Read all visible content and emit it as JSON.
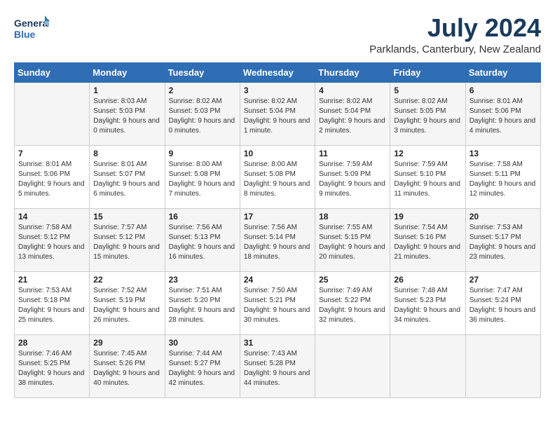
{
  "header": {
    "logo_line1": "General",
    "logo_line2": "Blue",
    "month_year": "July 2024",
    "location": "Parklands, Canterbury, New Zealand"
  },
  "days_of_week": [
    "Sunday",
    "Monday",
    "Tuesday",
    "Wednesday",
    "Thursday",
    "Friday",
    "Saturday"
  ],
  "weeks": [
    [
      {
        "day": "",
        "sunrise": "",
        "sunset": "",
        "daylight": ""
      },
      {
        "day": "1",
        "sunrise": "Sunrise: 8:03 AM",
        "sunset": "Sunset: 5:03 PM",
        "daylight": "Daylight: 9 hours and 0 minutes."
      },
      {
        "day": "2",
        "sunrise": "Sunrise: 8:02 AM",
        "sunset": "Sunset: 5:03 PM",
        "daylight": "Daylight: 9 hours and 0 minutes."
      },
      {
        "day": "3",
        "sunrise": "Sunrise: 8:02 AM",
        "sunset": "Sunset: 5:04 PM",
        "daylight": "Daylight: 9 hours and 1 minute."
      },
      {
        "day": "4",
        "sunrise": "Sunrise: 8:02 AM",
        "sunset": "Sunset: 5:04 PM",
        "daylight": "Daylight: 9 hours and 2 minutes."
      },
      {
        "day": "5",
        "sunrise": "Sunrise: 8:02 AM",
        "sunset": "Sunset: 5:05 PM",
        "daylight": "Daylight: 9 hours and 3 minutes."
      },
      {
        "day": "6",
        "sunrise": "Sunrise: 8:01 AM",
        "sunset": "Sunset: 5:06 PM",
        "daylight": "Daylight: 9 hours and 4 minutes."
      }
    ],
    [
      {
        "day": "7",
        "sunrise": "Sunrise: 8:01 AM",
        "sunset": "Sunset: 5:06 PM",
        "daylight": "Daylight: 9 hours and 5 minutes."
      },
      {
        "day": "8",
        "sunrise": "Sunrise: 8:01 AM",
        "sunset": "Sunset: 5:07 PM",
        "daylight": "Daylight: 9 hours and 6 minutes."
      },
      {
        "day": "9",
        "sunrise": "Sunrise: 8:00 AM",
        "sunset": "Sunset: 5:08 PM",
        "daylight": "Daylight: 9 hours and 7 minutes."
      },
      {
        "day": "10",
        "sunrise": "Sunrise: 8:00 AM",
        "sunset": "Sunset: 5:08 PM",
        "daylight": "Daylight: 9 hours and 8 minutes."
      },
      {
        "day": "11",
        "sunrise": "Sunrise: 7:59 AM",
        "sunset": "Sunset: 5:09 PM",
        "daylight": "Daylight: 9 hours and 9 minutes."
      },
      {
        "day": "12",
        "sunrise": "Sunrise: 7:59 AM",
        "sunset": "Sunset: 5:10 PM",
        "daylight": "Daylight: 9 hours and 11 minutes."
      },
      {
        "day": "13",
        "sunrise": "Sunrise: 7:58 AM",
        "sunset": "Sunset: 5:11 PM",
        "daylight": "Daylight: 9 hours and 12 minutes."
      }
    ],
    [
      {
        "day": "14",
        "sunrise": "Sunrise: 7:58 AM",
        "sunset": "Sunset: 5:12 PM",
        "daylight": "Daylight: 9 hours and 13 minutes."
      },
      {
        "day": "15",
        "sunrise": "Sunrise: 7:57 AM",
        "sunset": "Sunset: 5:12 PM",
        "daylight": "Daylight: 9 hours and 15 minutes."
      },
      {
        "day": "16",
        "sunrise": "Sunrise: 7:56 AM",
        "sunset": "Sunset: 5:13 PM",
        "daylight": "Daylight: 9 hours and 16 minutes."
      },
      {
        "day": "17",
        "sunrise": "Sunrise: 7:56 AM",
        "sunset": "Sunset: 5:14 PM",
        "daylight": "Daylight: 9 hours and 18 minutes."
      },
      {
        "day": "18",
        "sunrise": "Sunrise: 7:55 AM",
        "sunset": "Sunset: 5:15 PM",
        "daylight": "Daylight: 9 hours and 20 minutes."
      },
      {
        "day": "19",
        "sunrise": "Sunrise: 7:54 AM",
        "sunset": "Sunset: 5:16 PM",
        "daylight": "Daylight: 9 hours and 21 minutes."
      },
      {
        "day": "20",
        "sunrise": "Sunrise: 7:53 AM",
        "sunset": "Sunset: 5:17 PM",
        "daylight": "Daylight: 9 hours and 23 minutes."
      }
    ],
    [
      {
        "day": "21",
        "sunrise": "Sunrise: 7:53 AM",
        "sunset": "Sunset: 5:18 PM",
        "daylight": "Daylight: 9 hours and 25 minutes."
      },
      {
        "day": "22",
        "sunrise": "Sunrise: 7:52 AM",
        "sunset": "Sunset: 5:19 PM",
        "daylight": "Daylight: 9 hours and 26 minutes."
      },
      {
        "day": "23",
        "sunrise": "Sunrise: 7:51 AM",
        "sunset": "Sunset: 5:20 PM",
        "daylight": "Daylight: 9 hours and 28 minutes."
      },
      {
        "day": "24",
        "sunrise": "Sunrise: 7:50 AM",
        "sunset": "Sunset: 5:21 PM",
        "daylight": "Daylight: 9 hours and 30 minutes."
      },
      {
        "day": "25",
        "sunrise": "Sunrise: 7:49 AM",
        "sunset": "Sunset: 5:22 PM",
        "daylight": "Daylight: 9 hours and 32 minutes."
      },
      {
        "day": "26",
        "sunrise": "Sunrise: 7:48 AM",
        "sunset": "Sunset: 5:23 PM",
        "daylight": "Daylight: 9 hours and 34 minutes."
      },
      {
        "day": "27",
        "sunrise": "Sunrise: 7:47 AM",
        "sunset": "Sunset: 5:24 PM",
        "daylight": "Daylight: 9 hours and 36 minutes."
      }
    ],
    [
      {
        "day": "28",
        "sunrise": "Sunrise: 7:46 AM",
        "sunset": "Sunset: 5:25 PM",
        "daylight": "Daylight: 9 hours and 38 minutes."
      },
      {
        "day": "29",
        "sunrise": "Sunrise: 7:45 AM",
        "sunset": "Sunset: 5:26 PM",
        "daylight": "Daylight: 9 hours and 40 minutes."
      },
      {
        "day": "30",
        "sunrise": "Sunrise: 7:44 AM",
        "sunset": "Sunset: 5:27 PM",
        "daylight": "Daylight: 9 hours and 42 minutes."
      },
      {
        "day": "31",
        "sunrise": "Sunrise: 7:43 AM",
        "sunset": "Sunset: 5:28 PM",
        "daylight": "Daylight: 9 hours and 44 minutes."
      },
      {
        "day": "",
        "sunrise": "",
        "sunset": "",
        "daylight": ""
      },
      {
        "day": "",
        "sunrise": "",
        "sunset": "",
        "daylight": ""
      },
      {
        "day": "",
        "sunrise": "",
        "sunset": "",
        "daylight": ""
      }
    ]
  ]
}
